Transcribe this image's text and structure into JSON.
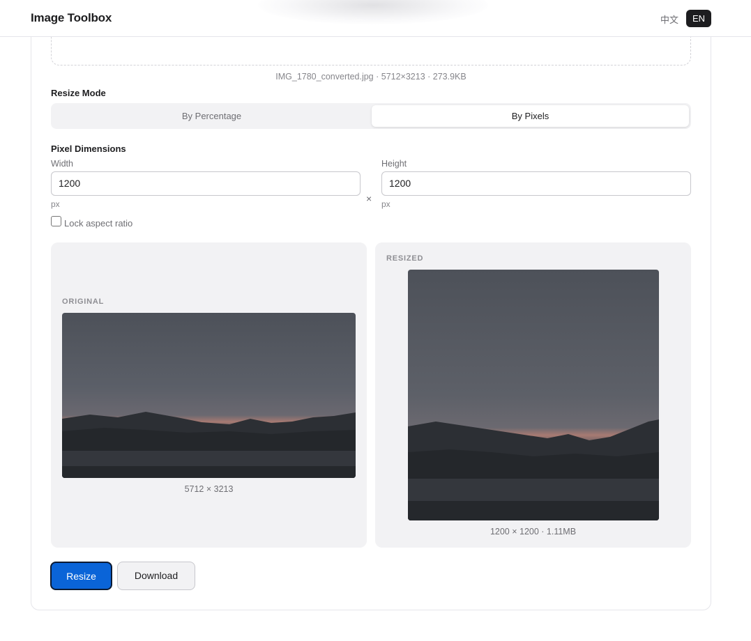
{
  "app": {
    "title": "Image Toolbox"
  },
  "language": {
    "zh_label": "中文",
    "en_label": "EN",
    "active": "EN"
  },
  "file": {
    "info": "IMG_1780_converted.jpg · 5712×3213 · 273.9KB"
  },
  "resize_mode": {
    "label": "Resize Mode",
    "options": [
      "By Percentage",
      "By Pixels"
    ],
    "selected": "By Pixels"
  },
  "pixel_dimensions": {
    "label": "Pixel Dimensions",
    "width": {
      "label": "Width",
      "value": "1200",
      "unit": "px"
    },
    "height": {
      "label": "Height",
      "value": "1200",
      "unit": "px"
    },
    "separator": "×",
    "lock_aspect_ratio": {
      "label": "Lock aspect ratio",
      "checked": false
    }
  },
  "preview": {
    "original": {
      "tag": "ORIGINAL",
      "caption": "5712 × 3213"
    },
    "resized": {
      "tag": "RESIZED",
      "caption": "1200 × 1200 · 1.11MB"
    }
  },
  "actions": {
    "resize_label": "Resize",
    "download_label": "Download"
  },
  "colors": {
    "accent": "#0a64d8",
    "dark": "#1d1d1f",
    "panel_bg": "#f2f2f4"
  }
}
